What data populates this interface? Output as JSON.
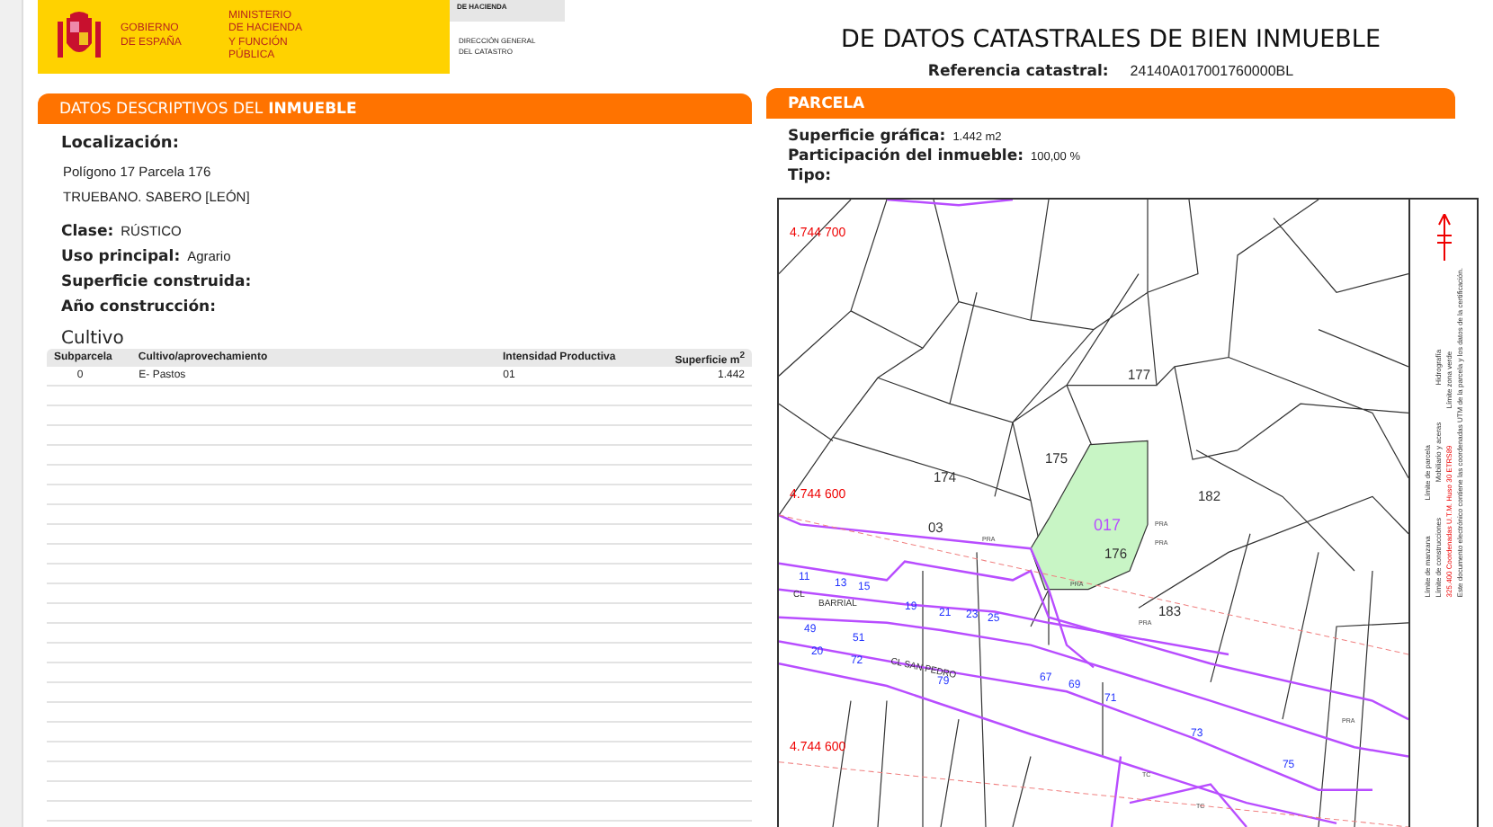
{
  "header": {
    "logo": {
      "government": [
        "GOBIERNO",
        "DE ESPAÑA"
      ],
      "ministry": [
        "MINISTERIO",
        "DE HACIENDA",
        "Y FUNCIÓN PÚBLICA"
      ]
    },
    "agency_top": "DE HACIENDA",
    "agency": [
      "DIRECCIÓN GENERAL",
      "DEL CATASTRO"
    ],
    "title": "DE DATOS CATASTRALES DE BIEN INMUEBLE",
    "reference_label": "Referencia catastral:",
    "reference": "24140A017001760000BL"
  },
  "left_panel": {
    "title_plain": "DATOS DESCRIPTIVOS DEL",
    "title_bold": "INMUEBLE",
    "location_label": "Localización:",
    "location_lines": [
      "Polígono 17 Parcela 176",
      "TRUEBANO. SABERO [LEÓN]"
    ],
    "fields": [
      {
        "label": "Clase:",
        "value": "RÚSTICO"
      },
      {
        "label": "Uso principal:",
        "value": "Agrario"
      },
      {
        "label": "Superficie construida:"
      },
      {
        "label": "Año construcción:"
      }
    ],
    "crop_title": "Cultivo",
    "table": {
      "columns": [
        "Subparcela",
        "Cultivo/aprovechamiento",
        "Intensidad Productiva",
        "Superficie m$^{2}$"
      ],
      "rows": [
        [
          "0",
          "E- Pastos",
          "01",
          "1.442"
        ]
      ]
    }
  },
  "right_panel": {
    "title": "PARCELA",
    "fields": [
      {
        "label": "Superficie gráfica:",
        "value": "1.442 m2"
      },
      {
        "label": "Participación del inmueble:",
        "value": "100,00 %"
      },
      {
        "label": "Tipo:"
      }
    ],
    "map": {
      "coordinates": [
        "4.744 700",
        "4.744 600",
        "4.744 600"
      ],
      "parcels": [
        "177",
        "175",
        "174",
        "182",
        "176",
        "03",
        "183"
      ],
      "polygon": "017",
      "streets": [
        "CL",
        "BARRIAL",
        "CL  SAN PEDRO"
      ],
      "house_numbers": [
        "11",
        "13",
        "15",
        "19",
        "21",
        "23",
        "25",
        "49",
        "51",
        "20",
        "72",
        "79",
        "67",
        "69",
        "71",
        "73",
        "75"
      ],
      "use_codes": [
        "PRA",
        "PRA",
        "PRA",
        "PRA",
        "PRA",
        "PRA",
        "TC",
        "TC"
      ],
      "legend": [
        [
          "Límite de manzana",
          "Límite de parcela"
        ],
        [
          "Límite de construcciones",
          "Mobiliario y aceras",
          "Hidrografía"
        ],
        [
          "325.400 Coordenadas U.T.M. Huso 30 ETRS89",
          "Límite zona verde"
        ],
        [
          "Este documento electrónico contiene las coordenadas UTM de la parcela y los datos de la certificación."
        ]
      ]
    }
  }
}
